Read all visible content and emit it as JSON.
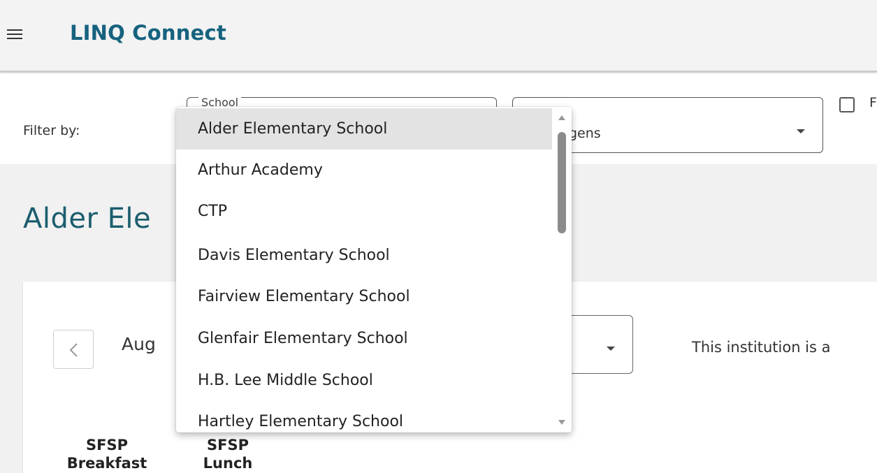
{
  "header": {
    "brand": "LINQ Connect",
    "menu_icon": "hamburger-menu-icon"
  },
  "filters": {
    "label": "Filter by:",
    "school_legend": "School",
    "allergen_text": "gens",
    "checkbox_label": "F",
    "checkbox_checked": false
  },
  "page": {
    "title": "Alder Ele"
  },
  "calendar": {
    "month_label": "Aug",
    "prev_icon": "chevron-left-icon",
    "notice": "This institution is a"
  },
  "columns": [
    {
      "line1": "SFSP",
      "line2": "Breakfast"
    },
    {
      "line1": "SFSP",
      "line2": "Lunch"
    }
  ],
  "school_dropdown": {
    "selected_index": 0,
    "options": [
      "Alder Elementary School",
      "Arthur Academy",
      "CTP",
      "Davis Elementary School",
      "Fairview Elementary School",
      "Glenfair Elementary School",
      "H.B. Lee Middle School",
      "Hartley Elementary School"
    ]
  },
  "colors": {
    "brand": "#16627f",
    "title": "#1a5d6e",
    "selected_option": "#e3e3e3"
  }
}
